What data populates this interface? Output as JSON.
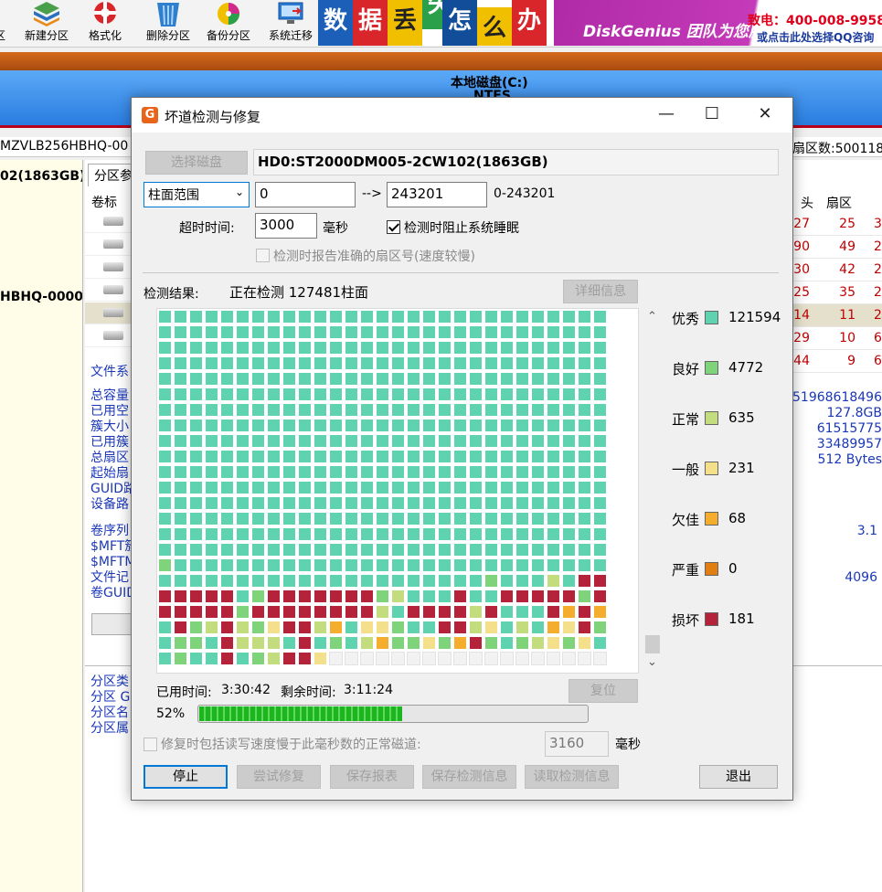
{
  "toolbar": {
    "items": [
      {
        "label": "区"
      },
      {
        "label": "新建分区"
      },
      {
        "label": "格式化"
      },
      {
        "label": "删除分区"
      },
      {
        "label": "备份分区"
      },
      {
        "label": "系统迁移"
      }
    ]
  },
  "banner": {
    "chars": [
      "数",
      "据",
      "丢",
      "失",
      "怎",
      "么",
      "办"
    ],
    "brand": "DiskGenius 团队为您服务",
    "phone": "致电：400-008-9958",
    "qq": "或点击此处选择QQ咨询"
  },
  "disk_header": {
    "label": "本地磁盘(C:)",
    "fs": "NTFS"
  },
  "model_row": {
    "left": "MZVLB256HBHQ-00",
    "right": "扇区数:500118"
  },
  "left_panel": {
    "disk": "02(1863GB)",
    "model": "HBHQ-0000"
  },
  "main_panel": {
    "tab": "分区参数",
    "col_volume": "卷标",
    "info1": [
      "文件系",
      "",
      "总容量",
      "已用空",
      "簇大小",
      "已用簇",
      "总扇区",
      "起始扇",
      "GUID路",
      "设备路"
    ],
    "info2": [
      "卷序列",
      "$MFT簇",
      "$MFTM",
      "文件记",
      "卷GUID"
    ],
    "info3": [
      "分区类",
      "分区 G",
      "分区名",
      "分区属"
    ]
  },
  "right_table": {
    "headers": [
      "头",
      "扇区"
    ],
    "rows": [
      {
        "head": "27",
        "sector": "25",
        "extra": "3"
      },
      {
        "head": "90",
        "sector": "49",
        "extra": "2"
      },
      {
        "head": "30",
        "sector": "42",
        "extra": "2"
      },
      {
        "head": "25",
        "sector": "35",
        "extra": "2"
      },
      {
        "head": "14",
        "sector": "11",
        "extra": "2"
      },
      {
        "head": "29",
        "sector": "10",
        "extra": "6"
      },
      {
        "head": "44",
        "sector": "9",
        "extra": "6"
      }
    ],
    "info": [
      "51968618496",
      "127.8GB",
      "61515775",
      "33489957",
      "512 Bytes"
    ],
    "version": "3.1",
    "record": "4096"
  },
  "dialog": {
    "title": "坏道检测与修复",
    "select_disk_label": "选择磁盘",
    "disk_name": "HD0:ST2000DM005-2CW102(1863GB)",
    "range_mode": "柱面范围",
    "range_start": "0",
    "range_arrow": "-->",
    "range_end": "243201",
    "range_total": "0-243201",
    "timeout_label": "超时时间:",
    "timeout_value": "3000",
    "timeout_unit": "毫秒",
    "prevent_sleep_label": "检测时阻止系统睡眠",
    "prevent_sleep_checked": true,
    "report_sector_label": "检测时报告准确的扇区号(速度较慢)",
    "result_label": "检测结果:",
    "result_status": "正在检测 127481柱面",
    "detail_button": "详细信息",
    "elapsed_label": "已用时间:",
    "elapsed_value": "3:30:42",
    "remaining_label": "剩余时间:",
    "remaining_value": "3:11:24",
    "reset_button": "复位",
    "progress_percent": 52,
    "progress_text": "52%",
    "repair_option_label": "修复时包括读写速度慢于此毫秒数的正常磁道:",
    "repair_threshold": "3160",
    "repair_unit": "毫秒",
    "buttons": {
      "stop": "停止",
      "try_repair": "尝试修复",
      "save_report": "保存报表",
      "save_info": "保存检测信息",
      "load_info": "读取检测信息",
      "exit": "退出"
    },
    "legend": [
      {
        "key": "excellent",
        "label": "优秀",
        "count": "121594",
        "color": "#5fd3b0"
      },
      {
        "key": "good",
        "label": "良好",
        "count": "4772",
        "color": "#7ed37b"
      },
      {
        "key": "normal",
        "label": "正常",
        "count": "635",
        "color": "#c3dc7e"
      },
      {
        "key": "fair",
        "label": "一般",
        "count": "231",
        "color": "#f4e08a"
      },
      {
        "key": "poor",
        "label": "欠佳",
        "count": "68",
        "color": "#f5ad2e"
      },
      {
        "key": "severe",
        "label": "严重",
        "count": "0",
        "color": "#e07e12"
      },
      {
        "key": "damaged",
        "label": "损坏",
        "count": "181",
        "color": "#b5233a"
      }
    ],
    "grid_colors": {
      "E": "#5fd3b0",
      "G": "#7ed37b",
      "N": "#c3dc7e",
      "F": "#f4e08a",
      "P": "#f5ad2e",
      "D": "#b5233a",
      "U": "#f2f2f2"
    },
    "grid_rows": [
      "EEEEEEEEEEEEEEEEEEEEEEEEEEEEE",
      "EEEEEEEEEEEEEEEEEEEEEEEEEEEEE",
      "EEEEEEEEEEEEEEEEEEEEEEEEEEEEE",
      "EEEEEEEEEEEEEEEEEEEEEEEEEEEEE",
      "EEEEEEEEEEEEEEEEEEEEEEEEEEEEE",
      "EEEEEEEEEEEEEEEEEEEEEEEEEEEEE",
      "EEEEEEEEEEEEEEEEEEEEEEEEEEEEE",
      "EEEEEEEEEEEEEEEEEEEEEEEEEEEEE",
      "EEEEEEEEEEEEEEEEEEEEEEEEEEEEE",
      "EEEEEEEEEEEEEEEEEEEEEEEEEEEEE",
      "EEEEEEEEEEEEEEEEEEEEEEEEEEEEE",
      "EEEEEEEEEEEEEEEEEEEEEEEEEEEEE",
      "EEEEEEEEEEEEEEEEEEEEEEEEEEEEE",
      "EEEEEEEEEEEEEEEEEEEEEEEEEEEEE",
      "EEEEEEEEEEEEEEEEEEEEEEEEEEEEE",
      "EEEEEEEEEEEEEEEEEEEEEEEEEEEEE",
      "GEEEEEEEEEEEEEEEEEEEEEEEEEEEE",
      "EEEEEEEEEEEEEEEEEEEEEGEEENEDD",
      "DDDDDEGDDDDDDDGNEEEDEEDDDDDGD",
      "DDDDDGDDDDDDDDNEDDDDNDEEEDPDP",
      "EDGNDNGFDDNPEFFGEEDDNFENEPFDG",
      "EGGEDNNNEDEGENPGGFGPDGEGNFGFE",
      "EGEEDEGNDDFUUUUUUUUUUUUUUUUUU"
    ]
  }
}
